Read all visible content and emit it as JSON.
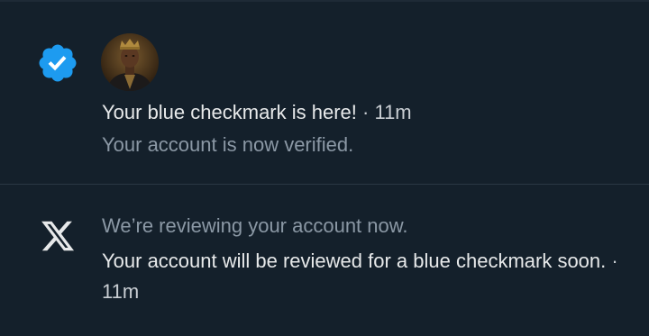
{
  "notifications": [
    {
      "icon": "verified-badge-icon",
      "icon_color": "#1d9bf0",
      "title": "Your blue checkmark is here!",
      "separator": "·",
      "time": "11m",
      "subtitle": "Your account is now verified."
    },
    {
      "icon": "x-logo-icon",
      "title": "We’re reviewing your account now.",
      "body": "Your account will be reviewed for a blue checkmark soon.",
      "separator": "·",
      "time": "11m"
    }
  ],
  "colors": {
    "background": "#14202b",
    "primary_text": "#e7e9ea",
    "secondary_text": "#8b98a5",
    "accent": "#1d9bf0",
    "divider": "#2a3744"
  }
}
